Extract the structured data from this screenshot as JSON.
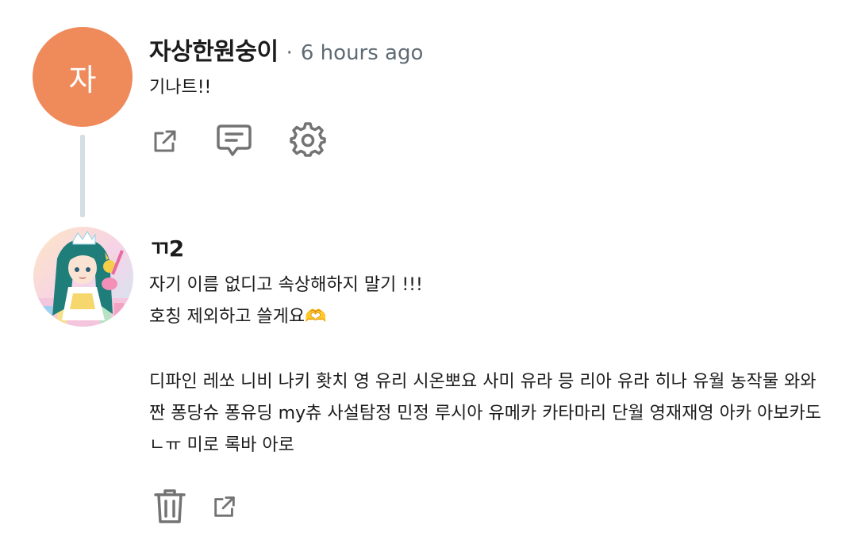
{
  "comments": [
    {
      "avatar_letter": "자",
      "author": "자상한원숭이",
      "separator": "·",
      "time": "6 hours ago",
      "body": "기나트!!",
      "actions": [
        "share-icon",
        "reply-icon",
        "settings-icon"
      ]
    },
    {
      "author": "ㄲ2",
      "body_line1": "자기 이름 없디고 속상해하지 말기 !!!",
      "body_line2": "호칭 제외하고 쓸게요🫶",
      "body_paragraph": "디파인 레쏘 니비 나키 홧치 영 유리 시온뽀요 사미 유라 믕 리아 유라 히나 유월 농작물 와와짠 퐁당슈 퐁유딩 my츄 사설탐정 민정 루시아 유메카 카타마리 단월 영재재영 아카 아보카도 ㄴㅠ 미로 록바 아로",
      "actions": [
        "trash-icon",
        "share-icon"
      ]
    }
  ],
  "colors": {
    "avatar_bg": "#ef8a5b",
    "thread_line": "#d4dde3",
    "icon": "#737373",
    "meta_text": "#5f6b74"
  }
}
